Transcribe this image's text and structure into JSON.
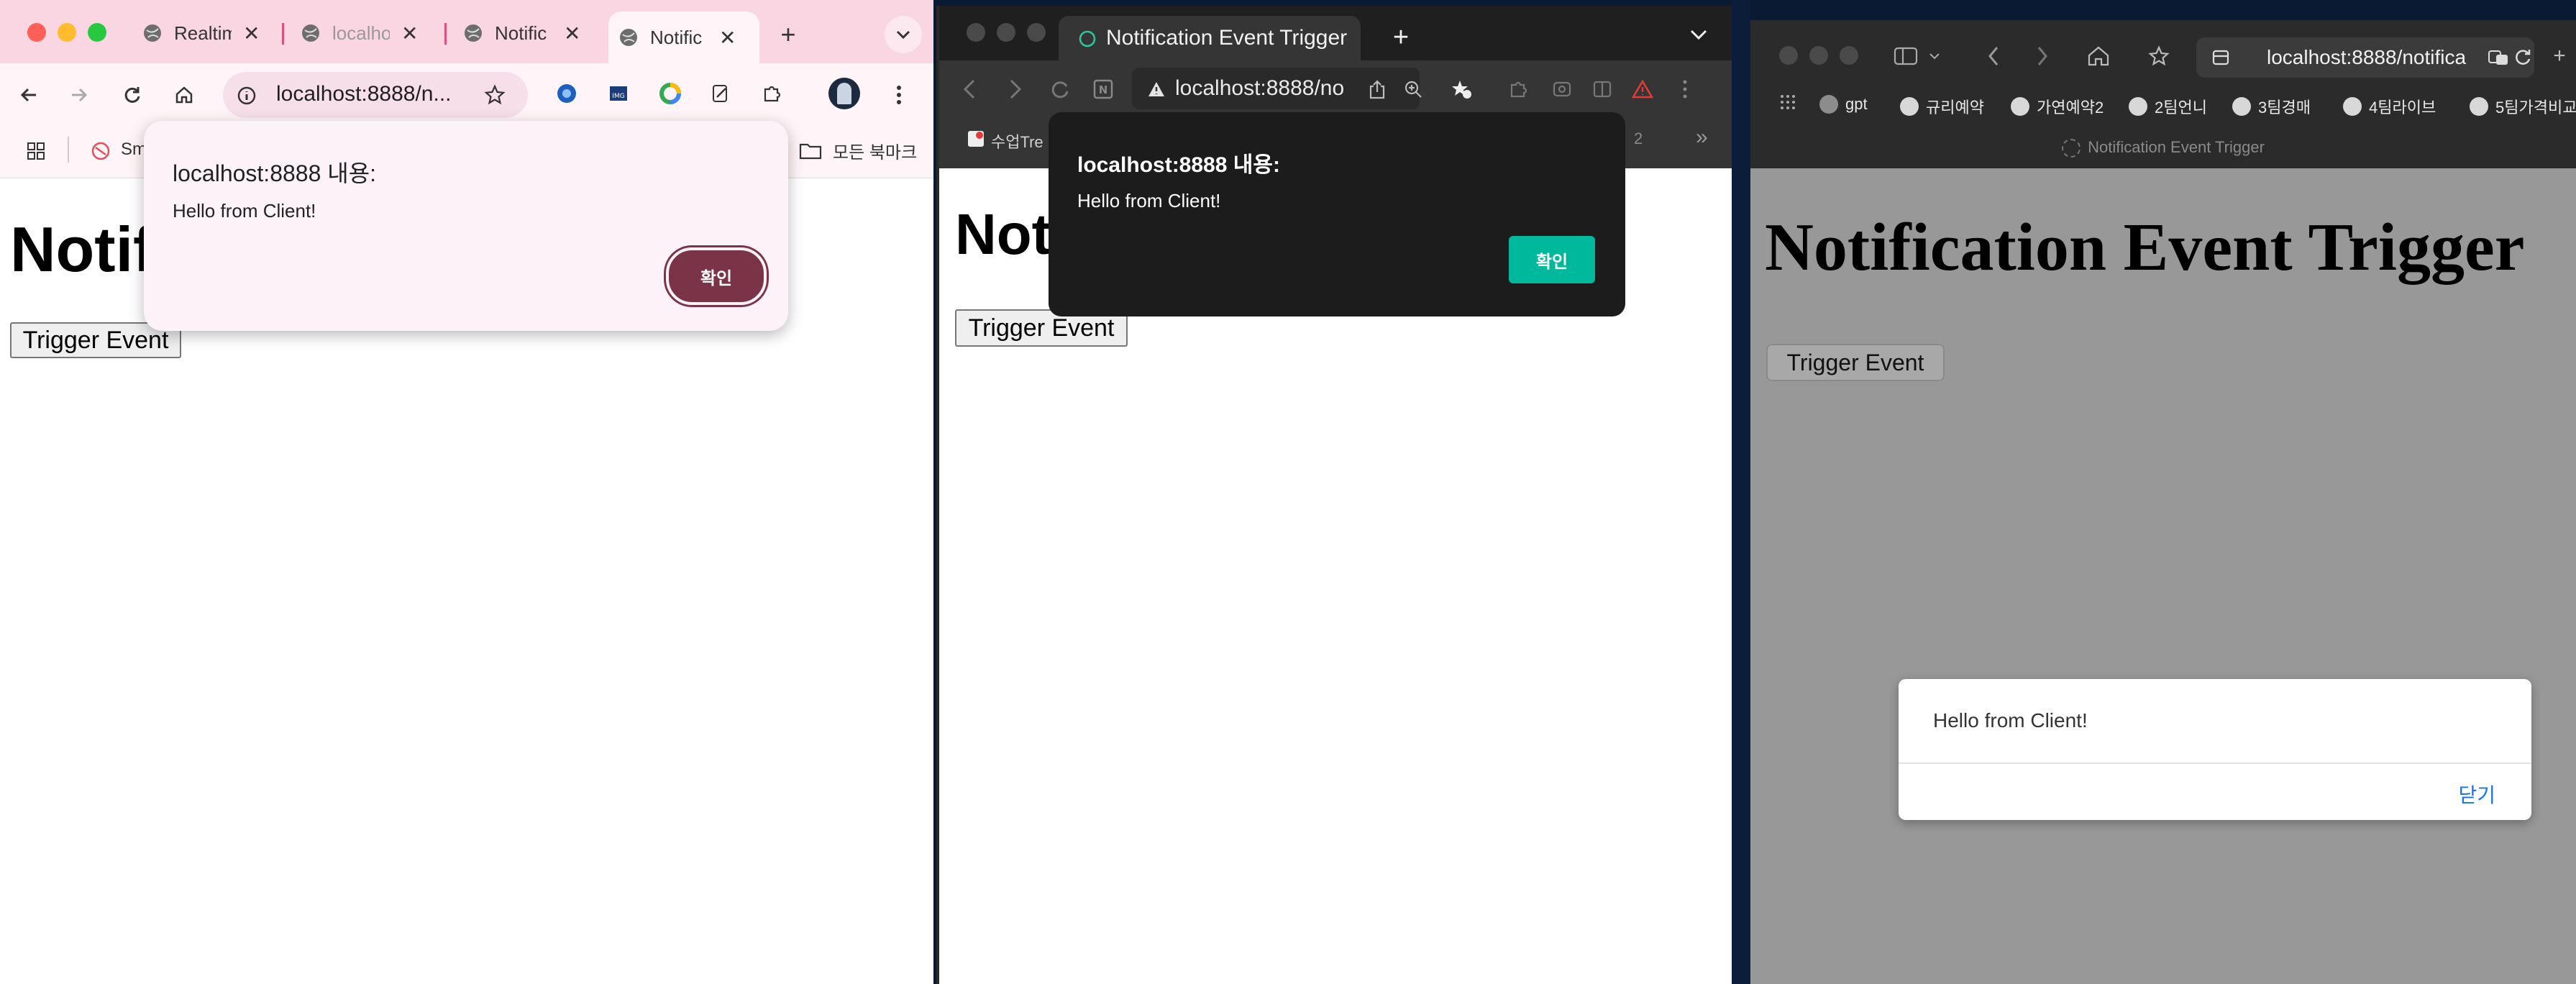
{
  "chrome": {
    "tabs": [
      {
        "title": "Realtim"
      },
      {
        "title": "localho"
      },
      {
        "title": "Notific"
      },
      {
        "title": "Notific"
      }
    ],
    "new_tab": "+",
    "url": "localhost:8888/n...",
    "bookmarks": {
      "first": "Sm",
      "all_bookmarks": "모든 북마크"
    },
    "page": {
      "heading": "Notif",
      "button": "Trigger Event"
    },
    "dialog": {
      "title": "localhost:8888 내용:",
      "message": "Hello from Client!",
      "ok": "확인"
    },
    "colors": {
      "tabbar": "#fad6e2",
      "dialog_bg": "#fdf2f7",
      "ok_button": "#7b3447"
    }
  },
  "browser2": {
    "tab_title": "Notification Event Trigger",
    "new_tab": "+",
    "url": "localhost:8888/no",
    "bookmarks": {
      "first": "수업Tre",
      "partial": "2",
      "more": "»"
    },
    "page": {
      "heading": "Noti",
      "button": "Trigger Event"
    },
    "dialog": {
      "title": "localhost:8888 내용:",
      "message": "Hello from Client!",
      "ok": "확인"
    },
    "colors": {
      "dialog_bg": "#1c1c1c",
      "ok_button": "#00b89c"
    }
  },
  "safari": {
    "url": "localhost:8888/notifica",
    "bookmarks": [
      "gpt",
      "규리예약",
      "가연예약2",
      "2팀언니",
      "3팀경매",
      "4팀라이브",
      "5팀가격비교"
    ],
    "tab_title": "Notification Event Trigger",
    "page": {
      "heading": "Notification Event Trigger",
      "button": "Trigger Event"
    },
    "dialog": {
      "message": "Hello from Client!",
      "close": "닫기"
    },
    "colors": {
      "page_dim": "#989898",
      "close_link": "#1a73e8"
    }
  }
}
